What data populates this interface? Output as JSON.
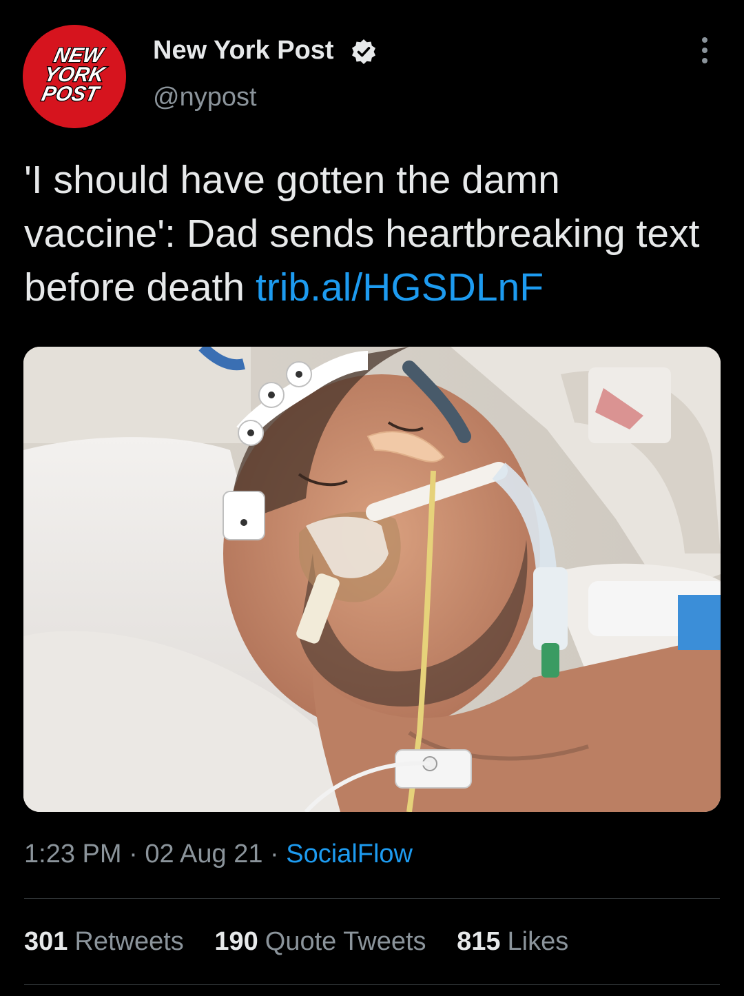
{
  "account": {
    "display_name": "New York Post",
    "handle": "@nypost",
    "verified": true,
    "avatar_icon": "nypost-logo-icon",
    "avatar_logo_lines": [
      "NEW",
      "YORK",
      "POST"
    ],
    "avatar_color": "#d6141e"
  },
  "tweet": {
    "text_main": "'I should have gotten the damn vaccine': Dad sends heartbreaking text before death ",
    "link": "trib.al/HGSDLnF"
  },
  "media": {
    "icon": "photo-hospital-patient-icon"
  },
  "meta": {
    "time": "1:23 PM",
    "separator": " · ",
    "date": "02 Aug 21",
    "source": "SocialFlow"
  },
  "stats": {
    "retweets_count": "301",
    "retweets_label": "Retweets",
    "quotes_count": "190",
    "quotes_label": "Quote Tweets",
    "likes_count": "815",
    "likes_label": "Likes"
  },
  "colors": {
    "background": "#000000",
    "text": "#e7e9ea",
    "secondary": "#8b949b",
    "link": "#1d9bf0",
    "divider": "#2f3336"
  }
}
